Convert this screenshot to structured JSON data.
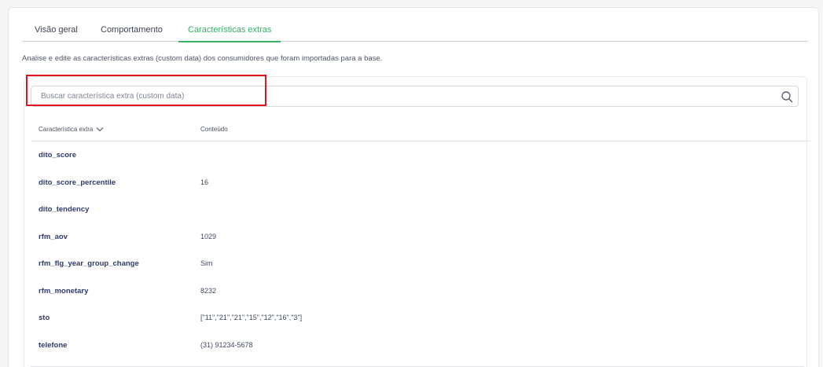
{
  "tabs": [
    {
      "label": "Visão geral"
    },
    {
      "label": "Comportamento"
    },
    {
      "label": "Características extras"
    }
  ],
  "description": "Analise e edite as características extras (custom data) dos consumidores que foram importadas para a base.",
  "search": {
    "placeholder": "Buscar característica extra (custom data)",
    "value": ""
  },
  "table": {
    "headers": {
      "key": "Característica extra",
      "value": "Conteúdo"
    },
    "rows": [
      {
        "key": "dito_score",
        "value": ""
      },
      {
        "key": "dito_score_percentile",
        "value": "16"
      },
      {
        "key": "dito_tendency",
        "value": ""
      },
      {
        "key": "rfm_aov",
        "value": "1029"
      },
      {
        "key": "rfm_flg_year_group_change",
        "value": "Sim"
      },
      {
        "key": "rfm_monetary",
        "value": "8232"
      },
      {
        "key": "sto",
        "value": "[\"11\",\"21\",\"21\",\"15\",\"12\",\"16\",\"3\"]"
      },
      {
        "key": "telefone",
        "value": "(31) 91234-5678"
      }
    ]
  },
  "colors": {
    "accent": "#35b264",
    "highlight": "#e3131b",
    "key_text": "#2f3a6b"
  }
}
